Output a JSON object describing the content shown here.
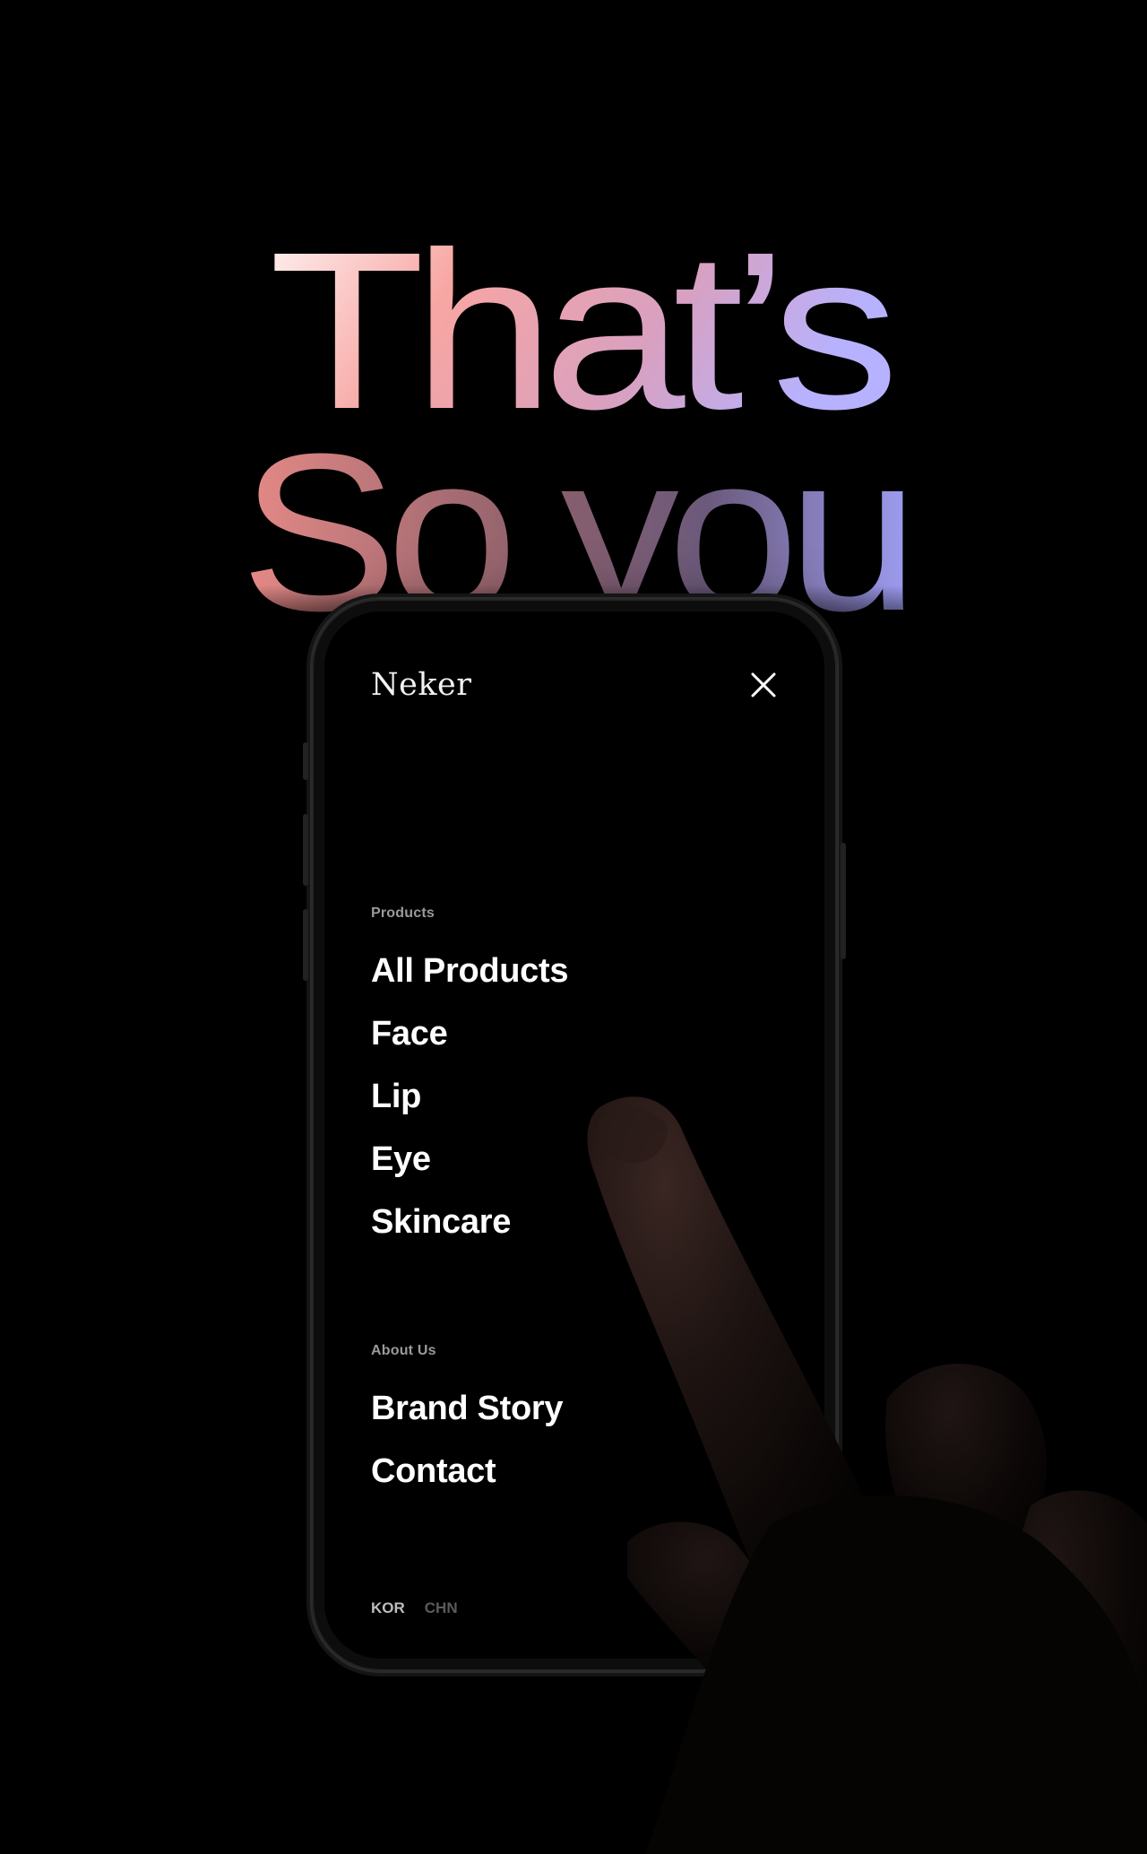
{
  "headline": {
    "line1": "That’s",
    "line2": "So you",
    "gradient_colors": [
      "#fde7e6",
      "#f39a9c",
      "#d79bb9",
      "#b8b0ff"
    ]
  },
  "phone_menu": {
    "brand": "Neker",
    "close_icon": "close-icon",
    "sections": [
      {
        "label": "Products",
        "items": [
          "All Products",
          "Face",
          "Lip",
          "Eye",
          "Skincare"
        ]
      },
      {
        "label": "About Us",
        "items": [
          "Brand Story",
          "Contact"
        ]
      }
    ],
    "languages": [
      "KOR",
      "CHN"
    ],
    "active_language": "KOR"
  },
  "colors": {
    "background": "#000000",
    "menu_text": "#ffffff",
    "section_label": "#9a9a9a",
    "inactive_language": "#5b5b5b"
  }
}
